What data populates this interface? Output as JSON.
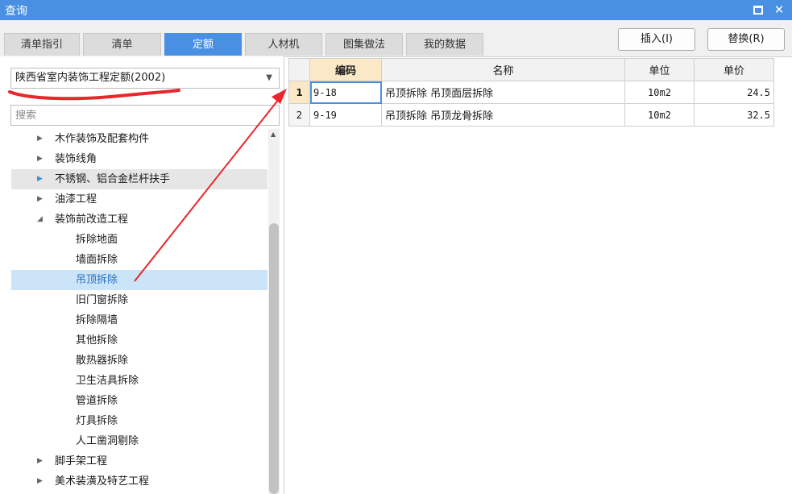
{
  "window": {
    "title": "查询"
  },
  "tabs": [
    {
      "label": "清单指引"
    },
    {
      "label": "清单"
    },
    {
      "label": "定额"
    },
    {
      "label": "人材机"
    },
    {
      "label": "图集做法"
    },
    {
      "label": "我的数据"
    }
  ],
  "actions": {
    "insert": "插入(I)",
    "replace": "替换(R)"
  },
  "quota_select": {
    "value": "陕西省室内装饰工程定额(2002)"
  },
  "search": {
    "placeholder": "搜索"
  },
  "tree": [
    {
      "label": "木作装饰及配套构件",
      "level": 1,
      "state": "collapsed"
    },
    {
      "label": "装饰线角",
      "level": 1,
      "state": "collapsed"
    },
    {
      "label": "不锈钢、铝合金栏杆扶手",
      "level": 1,
      "state": "collapsed"
    },
    {
      "label": "油漆工程",
      "level": 1,
      "state": "collapsed"
    },
    {
      "label": "装饰前改造工程",
      "level": 1,
      "state": "expanded"
    },
    {
      "label": "拆除地面",
      "level": 2
    },
    {
      "label": "墙面拆除",
      "level": 2
    },
    {
      "label": "吊顶拆除",
      "level": 2,
      "selected": true
    },
    {
      "label": "旧门窗拆除",
      "level": 2
    },
    {
      "label": "拆除隔墙",
      "level": 2
    },
    {
      "label": "其他拆除",
      "level": 2
    },
    {
      "label": "散热器拆除",
      "level": 2
    },
    {
      "label": "卫生洁具拆除",
      "level": 2
    },
    {
      "label": "管道拆除",
      "level": 2
    },
    {
      "label": "灯具拆除",
      "level": 2
    },
    {
      "label": "人工凿洞剔除",
      "level": 2
    },
    {
      "label": "脚手架工程",
      "level": 1,
      "state": "collapsed"
    },
    {
      "label": "美术装潢及特艺工程",
      "level": 1,
      "state": "collapsed"
    }
  ],
  "table": {
    "headers": {
      "code": "编码",
      "name": "名称",
      "unit": "单位",
      "price": "单价"
    },
    "rows": [
      {
        "num": "1",
        "code": "9-18",
        "name": "吊顶拆除 吊顶面层拆除",
        "unit": "10m2",
        "price": "24.5"
      },
      {
        "num": "2",
        "code": "9-19",
        "name": "吊顶拆除 吊顶龙骨拆除",
        "unit": "10m2",
        "price": "32.5"
      }
    ]
  },
  "colors": {
    "accent": "#4a90e2",
    "annotation": "#e8262b",
    "selected_bg": "#cce4f7"
  }
}
